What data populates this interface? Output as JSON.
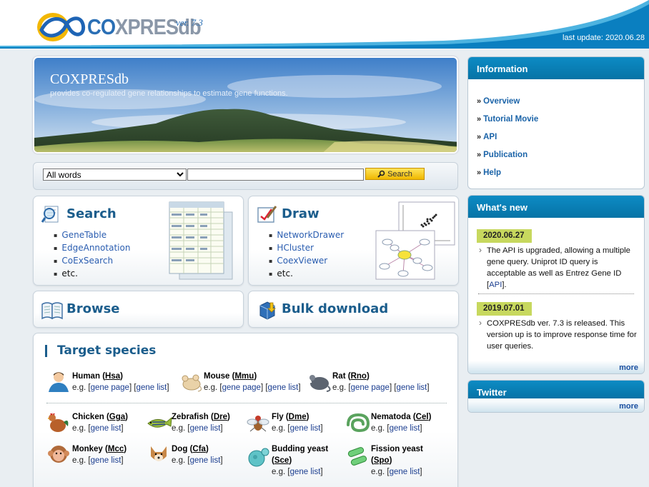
{
  "header": {
    "logo_text_co": "CO",
    "logo_text_rest": "XPRESdb",
    "version": "ver. 7.3",
    "last_update": "last update: 2020.06.28"
  },
  "hero": {
    "title": "COXPRESdb",
    "subtitle": "provides co-regulated gene relationships to estimate gene functions."
  },
  "search": {
    "mode_options": [
      "All words"
    ],
    "mode_selected": "All words",
    "query_value": "",
    "button_label": "Search"
  },
  "panels": {
    "search": {
      "title": "Search",
      "items": [
        "GeneTable",
        "EdgeAnnotation",
        "CoExSearch",
        "etc."
      ]
    },
    "draw": {
      "title": "Draw",
      "items": [
        "NetworkDrawer",
        "HCluster",
        "CoexViewer",
        "etc."
      ]
    },
    "browse": {
      "title": "Browse"
    },
    "bulk": {
      "title": "Bulk download"
    }
  },
  "species": {
    "title": "Target species",
    "eg": "e.g.",
    "gene_page": "gene page",
    "gene_list": "gene list",
    "rows": [
      {
        "name": "Human",
        "abbr": "Hsa"
      },
      {
        "name": "Mouse",
        "abbr": "Mmu"
      },
      {
        "name": "Rat",
        "abbr": "Rno"
      },
      {
        "name": "Chicken",
        "abbr": "Gga"
      },
      {
        "name": "Zebrafish",
        "abbr": "Dre"
      },
      {
        "name": "Fly",
        "abbr": "Dme"
      },
      {
        "name": "Nematoda",
        "abbr": "Cel"
      },
      {
        "name": "Monkey",
        "abbr": "Mcc"
      },
      {
        "name": "Dog",
        "abbr": "Cfa"
      },
      {
        "name": "Budding yeast",
        "abbr": "Sce"
      },
      {
        "name": "Fission yeast",
        "abbr": "Spo"
      }
    ]
  },
  "information": {
    "title": "Information",
    "items": [
      "Overview",
      "Tutorial Movie",
      "API",
      "Publication",
      "Help"
    ]
  },
  "whats_new": {
    "title": "What's new",
    "items": [
      {
        "date": "2020.06.27",
        "text_before": "The API is upgraded, allowing a multiple gene query. Uniprot ID query is acceptable as well as Entrez Gene ID [",
        "link": "API",
        "text_after": "]."
      },
      {
        "date": "2019.07.01",
        "text_before": "COXPRESdb ver. 7.3 is released. This version up is to improve response time for user queries.",
        "link": "",
        "text_after": ""
      }
    ],
    "more": "more"
  },
  "twitter": {
    "title": "Twitter",
    "more": "more"
  },
  "colors": {
    "header_blue": "#0a7fc0",
    "panel_title": "#1b5d8c",
    "news_date_bg": "#c7d85e",
    "search_button": "#f0b800"
  }
}
